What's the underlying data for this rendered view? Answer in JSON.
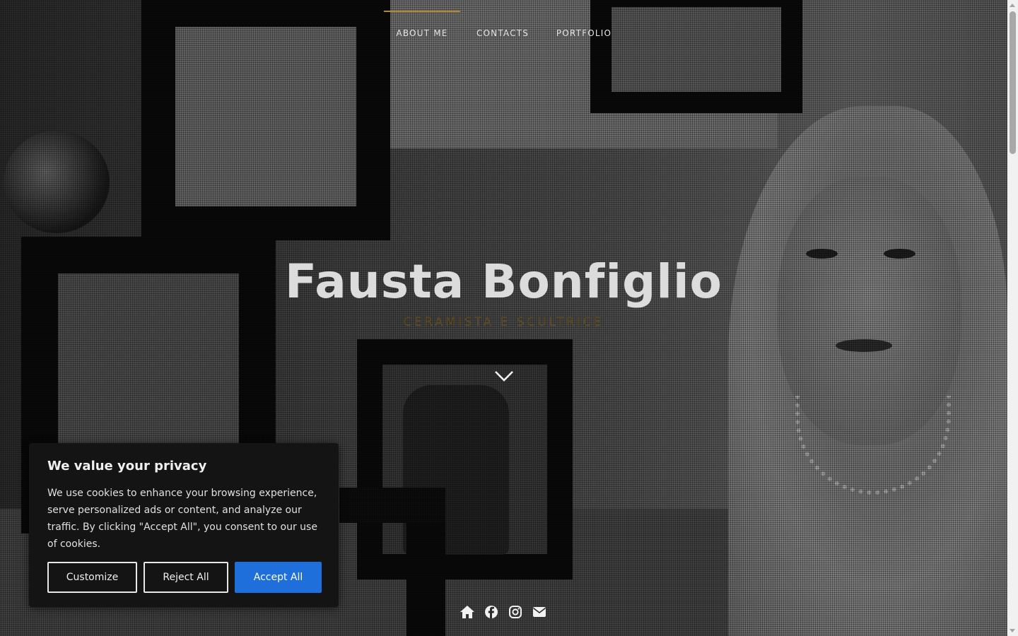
{
  "nav": {
    "items": [
      {
        "label": "ABOUT ME",
        "active": true
      },
      {
        "label": "CONTACTS",
        "active": false
      },
      {
        "label": "PORTFOLIO",
        "active": false
      }
    ],
    "accent_color": "#b38a2e"
  },
  "hero": {
    "title": "Fausta Bonfiglio",
    "subtitle": "CERAMISTA E SCULTRICE",
    "scroll_icon": "chevron-down-icon"
  },
  "social": {
    "icons": [
      "home-icon",
      "facebook-icon",
      "instagram-icon",
      "envelope-icon"
    ]
  },
  "cookie_banner": {
    "title": "We value your privacy",
    "text": "We use cookies to enhance your browsing experience, serve personalized ads or content, and analyze our traffic. By clicking \"Accept All\", you consent to our use of cookies.",
    "customize_label": "Customize",
    "reject_label": "Reject All",
    "accept_label": "Accept All",
    "accept_color": "#1e6fdc"
  }
}
